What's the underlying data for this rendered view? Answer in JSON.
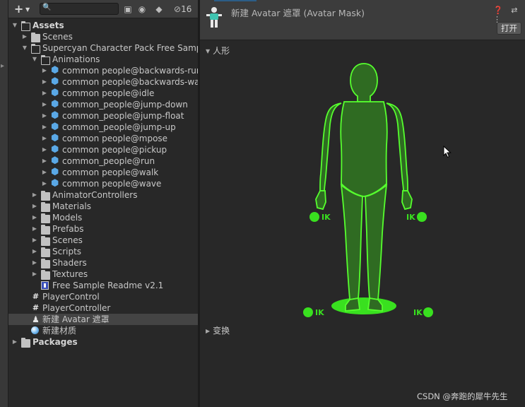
{
  "project": {
    "toolbar": {
      "add_label": "+",
      "search_value": "",
      "hidden_count": "16"
    },
    "tree": [
      {
        "label": "Assets",
        "depth": 0,
        "fold": "open",
        "icon": "folder-open",
        "bold": true
      },
      {
        "label": "Scenes",
        "depth": 1,
        "fold": "closed",
        "icon": "folder"
      },
      {
        "label": "Supercyan Character Pack Free Sample",
        "depth": 1,
        "fold": "open",
        "icon": "folder-open"
      },
      {
        "label": "Animations",
        "depth": 2,
        "fold": "open",
        "icon": "folder-open"
      },
      {
        "label": "common people@backwards-run",
        "depth": 3,
        "fold": "closed",
        "icon": "model"
      },
      {
        "label": "common people@backwards-walk",
        "depth": 3,
        "fold": "closed",
        "icon": "model"
      },
      {
        "label": "common people@idle",
        "depth": 3,
        "fold": "closed",
        "icon": "model"
      },
      {
        "label": "common_people@jump-down",
        "depth": 3,
        "fold": "closed",
        "icon": "model"
      },
      {
        "label": "common_people@jump-float",
        "depth": 3,
        "fold": "closed",
        "icon": "model"
      },
      {
        "label": "common_people@jump-up",
        "depth": 3,
        "fold": "closed",
        "icon": "model"
      },
      {
        "label": "common people@mpose",
        "depth": 3,
        "fold": "closed",
        "icon": "model"
      },
      {
        "label": "common people@pickup",
        "depth": 3,
        "fold": "closed",
        "icon": "model"
      },
      {
        "label": "common_people@run",
        "depth": 3,
        "fold": "closed",
        "icon": "model"
      },
      {
        "label": "common people@walk",
        "depth": 3,
        "fold": "closed",
        "icon": "model"
      },
      {
        "label": "common people@wave",
        "depth": 3,
        "fold": "closed",
        "icon": "model"
      },
      {
        "label": "AnimatorControllers",
        "depth": 2,
        "fold": "closed",
        "icon": "folder"
      },
      {
        "label": "Materials",
        "depth": 2,
        "fold": "closed",
        "icon": "folder"
      },
      {
        "label": "Models",
        "depth": 2,
        "fold": "closed",
        "icon": "folder"
      },
      {
        "label": "Prefabs",
        "depth": 2,
        "fold": "closed",
        "icon": "folder"
      },
      {
        "label": "Scenes",
        "depth": 2,
        "fold": "closed",
        "icon": "folder"
      },
      {
        "label": "Scripts",
        "depth": 2,
        "fold": "closed",
        "icon": "folder"
      },
      {
        "label": "Shaders",
        "depth": 2,
        "fold": "closed",
        "icon": "folder"
      },
      {
        "label": "Textures",
        "depth": 2,
        "fold": "closed",
        "icon": "folder"
      },
      {
        "label": "Free Sample Readme v2.1",
        "depth": 2,
        "fold": "none",
        "icon": "readme"
      },
      {
        "label": "PlayerControl",
        "depth": 1,
        "fold": "none",
        "icon": "script"
      },
      {
        "label": "PlayerController",
        "depth": 1,
        "fold": "none",
        "icon": "script"
      },
      {
        "label": "新建 Avatar 遮罩",
        "depth": 1,
        "fold": "none",
        "icon": "avatar-mask",
        "selected": true
      },
      {
        "label": "新建材质",
        "depth": 1,
        "fold": "none",
        "icon": "material"
      },
      {
        "label": "Packages",
        "depth": 0,
        "fold": "closed",
        "icon": "folder",
        "bold": true
      }
    ]
  },
  "inspector": {
    "title": "新建 Avatar 遮罩 (Avatar Mask)",
    "header_icons": "❓ ⇄ ⋮",
    "open_button": "打开",
    "body_section": "人形",
    "transform_section": "变换",
    "ik_label": "IK",
    "colors": {
      "active_green": "#39e01f",
      "figure_fill": "#2f6b22",
      "outline": "#56ff2e"
    }
  },
  "watermark": "CSDN @奔跑的犀牛先生"
}
